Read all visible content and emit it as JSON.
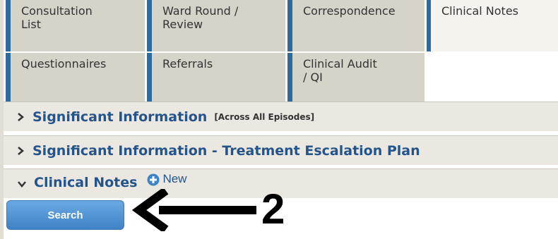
{
  "tabs": [
    {
      "id": "consultation-list",
      "label": "Consultation\nList",
      "active": false
    },
    {
      "id": "ward-round-review",
      "label": "Ward Round /\nReview",
      "active": false
    },
    {
      "id": "correspondence",
      "label": "Correspondence",
      "active": false
    },
    {
      "id": "clinical-notes",
      "label": "Clinical Notes",
      "active": true
    },
    {
      "id": "questionnaires",
      "label": "Questionnaires",
      "active": false
    },
    {
      "id": "referrals",
      "label": "Referrals",
      "active": false
    },
    {
      "id": "clinical-audit-qi",
      "label": "Clinical Audit\n/ QI",
      "active": false
    }
  ],
  "sections": [
    {
      "title": "Significant Information",
      "note": "[Across All Episodes]",
      "expanded": false
    },
    {
      "title": "Significant Information - Treatment Escalation Plan",
      "expanded": false
    },
    {
      "title": "Clinical Notes",
      "expanded": true
    }
  ],
  "new_button": {
    "label": "New",
    "icon": "plus-circle-icon"
  },
  "search_button": {
    "label": "Search"
  },
  "annotation": {
    "step_number": "2",
    "icon": "left-arrow-icon"
  },
  "colors": {
    "tab_bg": "#d6d3c9",
    "tab_active_bg": "#f4f3ee",
    "tab_accent": "#2e6b9c",
    "section_bg": "#ebe8e1",
    "section_title": "#24548a",
    "button_blue": "#4a8fd0"
  }
}
